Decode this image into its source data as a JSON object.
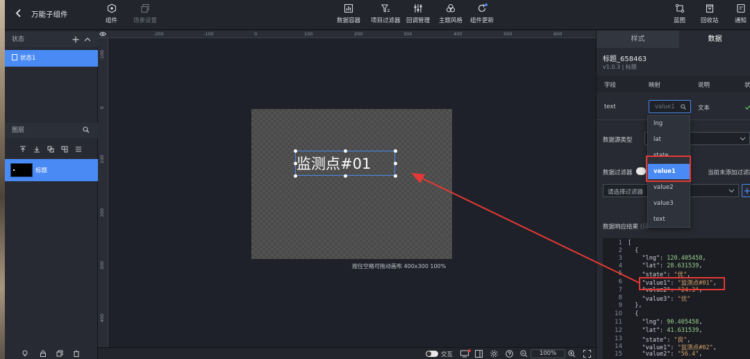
{
  "app": {
    "title": "万能子组件"
  },
  "toolbar": {
    "left": [
      {
        "label": "组件"
      },
      {
        "label": "场景设置"
      }
    ],
    "center": [
      {
        "label": "数据容器"
      },
      {
        "label": "项目过滤器"
      },
      {
        "label": "回调管理"
      },
      {
        "label": "主题风格"
      },
      {
        "label": "组件更新"
      }
    ],
    "right": [
      {
        "label": "蓝图"
      },
      {
        "label": "回收站"
      },
      {
        "label": "通知"
      }
    ]
  },
  "left_panel": {
    "states_title": "状态",
    "state_item": "状态1",
    "layers_title": "图层",
    "layer_item": "标题"
  },
  "ruler": {
    "h_ticks": [
      "-200",
      "-100",
      "0",
      "100",
      "200",
      "300",
      "400",
      "500",
      "600"
    ],
    "v_ticks": [
      "-100",
      "0",
      "100",
      "200",
      "300",
      "400"
    ]
  },
  "canvas": {
    "widget_text": "监测点#01",
    "hint": "按住空格可拖动画布  400x300 100%"
  },
  "bottom_bar": {
    "interact_label": "交互",
    "zoom": "100%"
  },
  "right_panel": {
    "tabs": [
      "样式",
      "数据"
    ],
    "component_name": "标题_658463",
    "component_meta": "v1.0.3 | 标题",
    "columns": [
      "字段",
      "映射",
      "说明",
      "状"
    ],
    "field_name": "text",
    "mapping_placeholder": "value1",
    "field_desc": "文本",
    "source_type_label": "数据源类型",
    "source_type_value": "接",
    "filter_label": "数据过滤器",
    "filter_status": "当前未添加过滤器",
    "filter_select_placeholder": "请选择过滤器",
    "response_label": "数据响应结果",
    "response_suffix": "(只",
    "dropdown_options": [
      "lng",
      "lat",
      "state",
      "value1",
      "value2",
      "value3",
      "text"
    ],
    "dropdown_selected": "value1",
    "code_lines": [
      {
        "n": "1",
        "t": "["
      },
      {
        "n": "2",
        "t": "  {"
      },
      {
        "n": "3",
        "t": "    \"lng\": 120.405458,"
      },
      {
        "n": "4",
        "t": "    \"lat\": 28.631539,"
      },
      {
        "n": "5",
        "t": "    \"state\": \"优\","
      },
      {
        "n": "6",
        "t": "    \"value1\": \"监测点#01\","
      },
      {
        "n": "7",
        "t": "    \"value2\": \"24.3\","
      },
      {
        "n": "8",
        "t": "    \"value3\": \"优\""
      },
      {
        "n": "9",
        "t": "  },"
      },
      {
        "n": "10",
        "t": "  {"
      },
      {
        "n": "11",
        "t": "    \"lng\": 90.405458,"
      },
      {
        "n": "12",
        "t": "    \"lat\": 41.631539,"
      },
      {
        "n": "13",
        "t": "    \"state\": \"良\","
      },
      {
        "n": "14",
        "t": "    \"value1\": \"监测点#02\","
      },
      {
        "n": "15",
        "t": "    \"value2\": \"56.4\","
      }
    ]
  },
  "colors": {
    "accent": "#4a8af4",
    "annotation": "#e53935",
    "bg": "#1c1f26",
    "panel": "#272a32"
  }
}
